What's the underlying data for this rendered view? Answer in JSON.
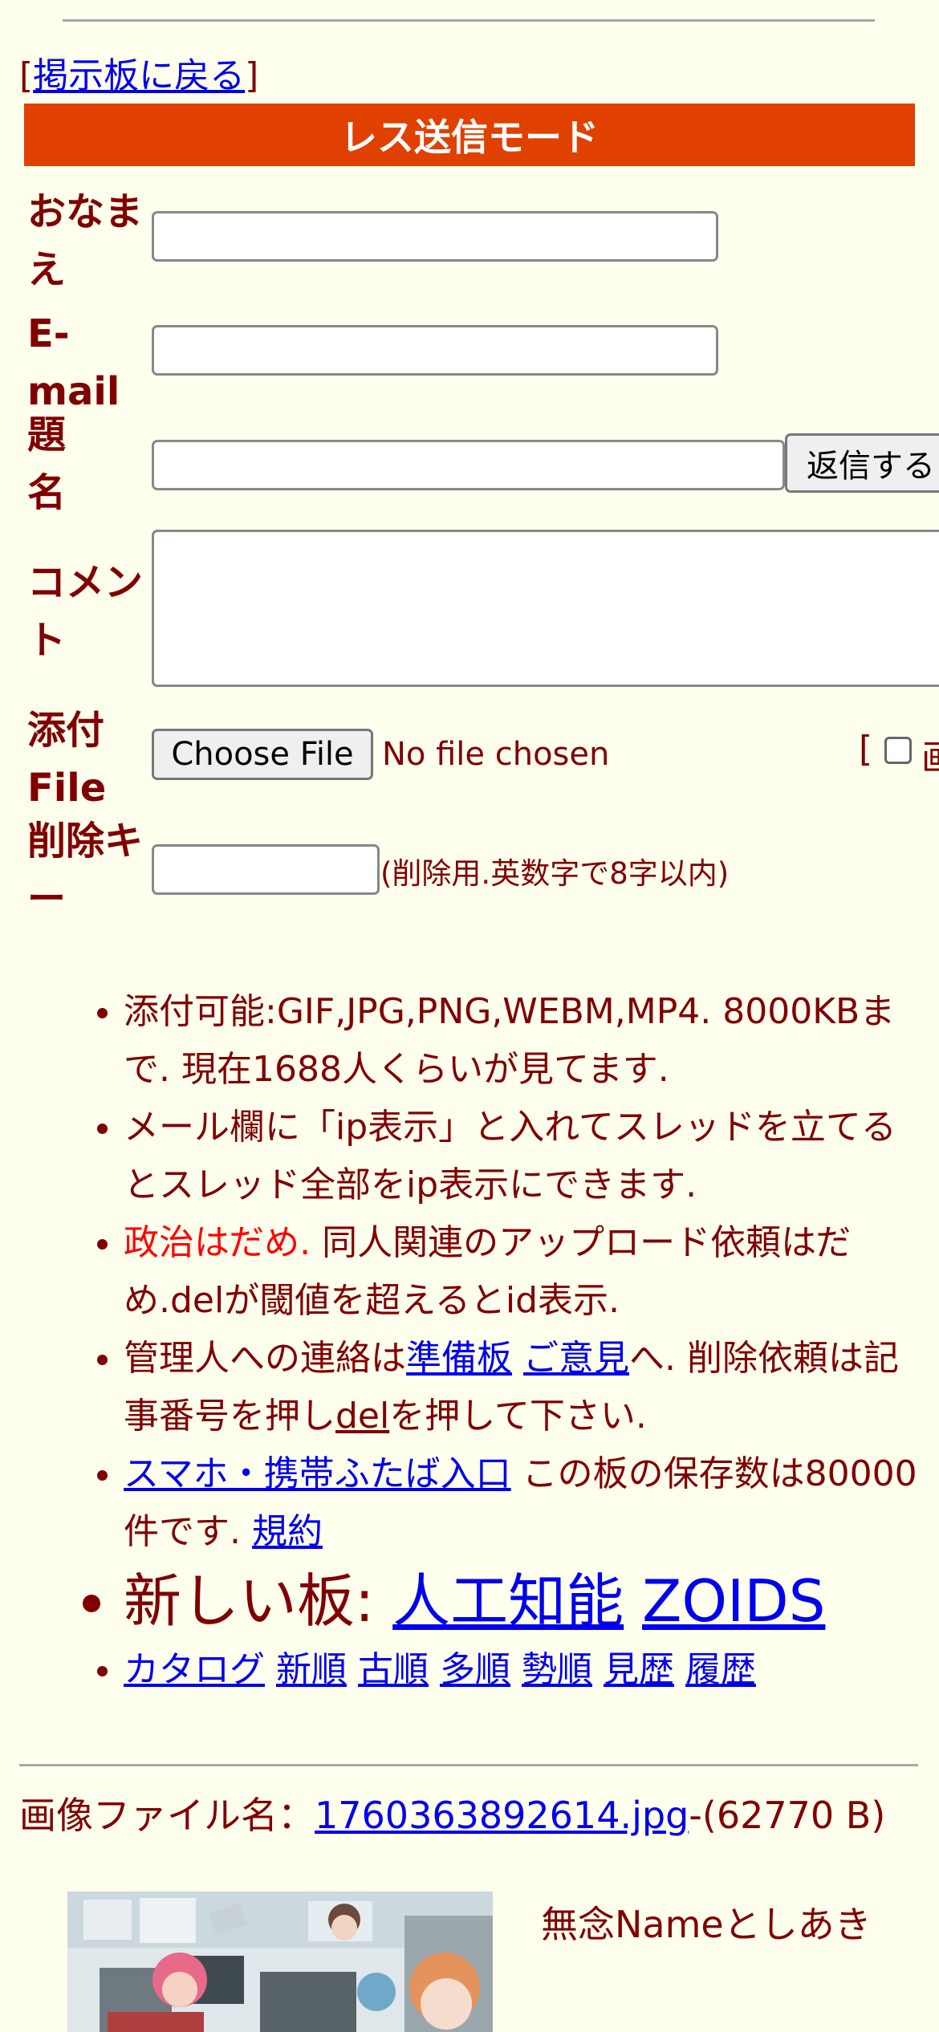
{
  "nav": {
    "back_open": "[",
    "back_link": "掲示板に戻る",
    "back_close": "]"
  },
  "form": {
    "mode_title": "レス送信モード",
    "name_label": "おなまえ",
    "email_label": "E-mail",
    "subject_label": "題名",
    "submit_label": "返信する",
    "comment_label": "コメント",
    "file_label": "添付File",
    "choose_file_label": "Choose File",
    "no_file_text": "No file chosen",
    "option_bracket": "[",
    "option_label": "画",
    "delkey_label": "削除キー",
    "delkey_hint": "(削除用.英数字で8字以内)"
  },
  "notes": {
    "n1": "添付可能:GIF,JPG,PNG,WEBM,MP4. 8000KBまで. 現在1688人くらいが見てます.",
    "n2": "メール欄に「ip表示」と入れてスレッドを立てるとスレッド全部をip表示にできます.",
    "n3_red": "政治はだめ.",
    "n3_rest": " 同人関連のアップロード依頼はだめ.delが閾値を超えるとid表示.",
    "n4_a": "管理人への連絡は",
    "n4_link1": "準備板",
    "n4_link2": "ご意見",
    "n4_b": "へ. 削除依頼は記事番号を押し",
    "n4_link3": "del",
    "n4_c": "を押して下さい.",
    "n5_link": "スマホ・携帯ふたば入口",
    "n5_a": " この板の保存数は80000件です. ",
    "n5_link2": "規約",
    "n6_label": "新しい板: ",
    "n6_link1": "人工知能",
    "n6_link2": "ZOIDS",
    "links": [
      "カタログ",
      "新順",
      "古順",
      "多順",
      "勢順",
      "見歴",
      "履歴"
    ]
  },
  "post": {
    "file_prefix": "画像ファイル名：",
    "file_link": "1760363892614.jpg",
    "file_size": "-(62770 B)",
    "poster": "無念Nameとしあき"
  },
  "colors": {
    "bg": "#ffffee",
    "text": "#800000",
    "mode_bar": "#e04000",
    "link": "#0000ee",
    "alert": "#ff0000"
  }
}
